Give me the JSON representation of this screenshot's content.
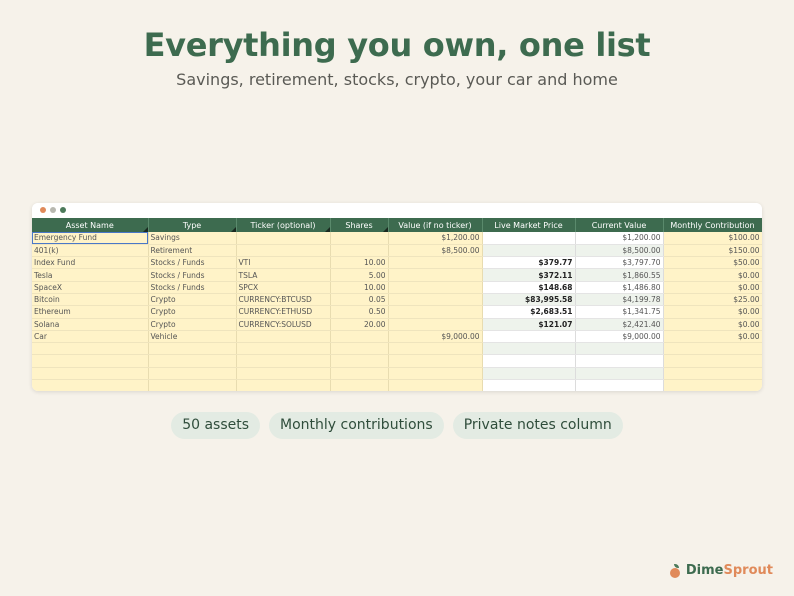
{
  "header": {
    "title": "Everything you own, one list",
    "subtitle": "Savings, retirement, stocks, crypto, your car and home"
  },
  "window": {
    "dot_colors": [
      "#e08a5a",
      "#b8b8b0",
      "#4c7a5a"
    ]
  },
  "sheet": {
    "columns": [
      "Asset Name",
      "Type",
      "Ticker (optional)",
      "Shares",
      "Value (if no ticker)",
      "Live Market Price",
      "Current Value",
      "Monthly Contribution"
    ],
    "rows": [
      [
        "Emergency Fund",
        "Savings",
        "",
        "",
        "$1,200.00",
        "",
        "$1,200.00",
        "$100.00"
      ],
      [
        "401(k)",
        "Retirement",
        "",
        "",
        "$8,500.00",
        "",
        "$8,500.00",
        "$150.00"
      ],
      [
        "Index Fund",
        "Stocks / Funds",
        "VTI",
        "10.00",
        "",
        "$379.77",
        "$3,797.70",
        "$50.00"
      ],
      [
        "Tesla",
        "Stocks / Funds",
        "TSLA",
        "5.00",
        "",
        "$372.11",
        "$1,860.55",
        "$0.00"
      ],
      [
        "SpaceX",
        "Stocks / Funds",
        "SPCX",
        "10.00",
        "",
        "$148.68",
        "$1,486.80",
        "$0.00"
      ],
      [
        "Bitcoin",
        "Crypto",
        "CURRENCY:BTCUSD",
        "0.05",
        "",
        "$83,995.58",
        "$4,199.78",
        "$25.00"
      ],
      [
        "Ethereum",
        "Crypto",
        "CURRENCY:ETHUSD",
        "0.50",
        "",
        "$2,683.51",
        "$1,341.75",
        "$0.00"
      ],
      [
        "Solana",
        "Crypto",
        "CURRENCY:SOLUSD",
        "20.00",
        "",
        "$121.07",
        "$2,421.40",
        "$0.00"
      ],
      [
        "Car",
        "Vehicle",
        "",
        "",
        "$9,000.00",
        "",
        "$9,000.00",
        "$0.00"
      ],
      [
        "",
        "",
        "",
        "",
        "",
        "",
        "",
        ""
      ],
      [
        "",
        "",
        "",
        "",
        "",
        "",
        "",
        ""
      ],
      [
        "",
        "",
        "",
        "",
        "",
        "",
        "",
        ""
      ],
      [
        "",
        "",
        "",
        "",
        "",
        "",
        "",
        ""
      ]
    ]
  },
  "pills": [
    "50 assets",
    "Monthly contributions",
    "Private notes column"
  ],
  "brand": {
    "part1": "Dime",
    "part2": "Sprout"
  },
  "colors": {
    "accent": "#3d6b4f",
    "input_cell": "#fff3c8",
    "calc_cell": "#eef3ec",
    "selection": "#4a78c8"
  }
}
